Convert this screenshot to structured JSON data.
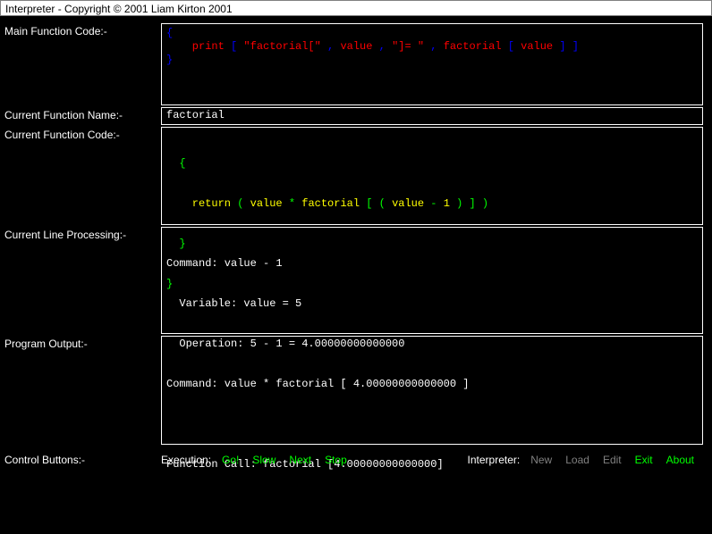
{
  "title": "Interpreter - Copyright © 2001 Liam Kirton 2001",
  "labels": {
    "mainFuncCode": "Main Function Code:-",
    "currentFuncName": "Current Function Name:-",
    "currentFuncCode": "Current Function Code:-",
    "currentLineProc": "Current Line Processing:-",
    "programOutput": "Program Output:-",
    "controlButtons": "Control Buttons:-"
  },
  "mainFunc": {
    "l1": "{",
    "l2a": "    print ",
    "l2b": "[ ",
    "l2c": "\"factorial[\" ",
    "l2d": ", ",
    "l2e": "value ",
    "l2f": ", ",
    "l2g": "\"]= \" ",
    "l2h": ", ",
    "l2i": "factorial ",
    "l2j": "[ ",
    "l2k": "value ",
    "l2l": "] ]",
    "l3": "}"
  },
  "funcName": "factorial",
  "funcCode": {
    "l1": "  {",
    "l2a": "    return ",
    "l2b": "( ",
    "l2c": "value ",
    "l2d": "* ",
    "l2e": "factorial ",
    "l2f": "[ ( ",
    "l2g": "value ",
    "l2h": "- ",
    "l2i": "1 ",
    "l2j": ") ] )",
    "l3": "  }",
    "l4": "}"
  },
  "lineProc": {
    "l1": "Command: value - 1",
    "l2": "  Variable: value = 5",
    "l3": "  Operation: 5 - 1 = 4.00000000000000",
    "l4": "Command: value * factorial [ 4.00000000000000 ]",
    "l5": "",
    "l6": "Function Call: factorial [4.00000000000000]"
  },
  "output": "",
  "controls": {
    "execLabel": "Execution:",
    "go": "Go!",
    "slow": "Slow",
    "next": "Next",
    "stop": "Stop",
    "interpLabel": "Interpreter:",
    "new": "New",
    "load": "Load",
    "edit": "Edit",
    "exit": "Exit",
    "about": "About"
  }
}
